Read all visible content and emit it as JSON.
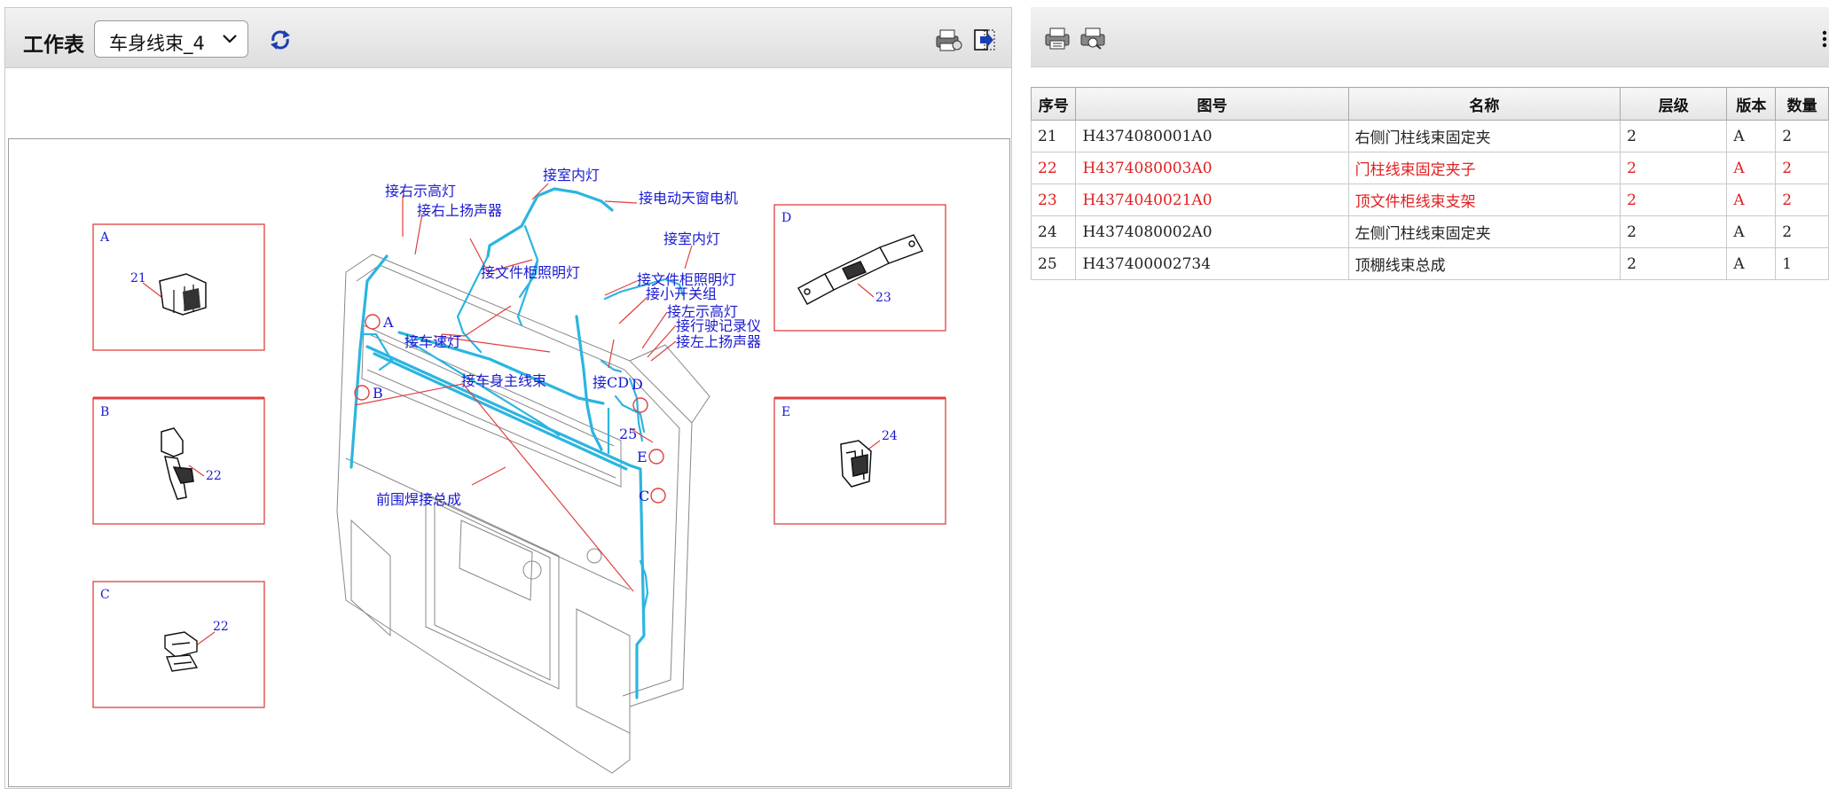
{
  "toolbar": {
    "worksheet_label": "工作表",
    "sheet_selected": "车身线束_4",
    "refresh_icon": "refresh-icon",
    "print_icon": "printer-icon",
    "exit_icon": "exit-icon"
  },
  "diagram": {
    "detail_boxes": [
      {
        "id": "A",
        "part": "21"
      },
      {
        "id": "B",
        "part": "22"
      },
      {
        "id": "C",
        "part": "22"
      },
      {
        "id": "D",
        "part": "23"
      },
      {
        "id": "E",
        "part": "24"
      }
    ],
    "labels": {
      "right_marker_light": "接右示高灯",
      "right_upper_speaker": "接右上扬声器",
      "dome_light_1": "接室内灯",
      "power_sunroof_motor": "接电动天窗电机",
      "cabinet_light_1": "接文件柜照明灯",
      "dome_light_2": "接室内灯",
      "cabinet_light_2": "接文件柜照明灯",
      "small_switch_group": "接小开关组",
      "left_marker_light": "接左示高灯",
      "tachograph": "接行驶记录仪",
      "left_upper_speaker": "接左上扬声器",
      "speed_light": "接车速灯",
      "body_main_harness": "接车身主线束",
      "cd": "接CD",
      "front_panel_weld": "前围焊接总成",
      "part_25": "25"
    },
    "markers": {
      "a": "A",
      "b": "B",
      "c": "C",
      "d": "D",
      "e": "E"
    },
    "colors": {
      "harness": "#2bb5e0",
      "annotation": "#1a1ad2",
      "detail_frame": "#e04040"
    }
  },
  "right_toolbar": {
    "print_icon_1": "printer-icon",
    "print_icon_2": "print-preview-icon"
  },
  "table": {
    "headers": [
      "序号",
      "图号",
      "名称",
      "层级",
      "版本",
      "数量"
    ],
    "rows": [
      {
        "seq": "21",
        "part_no": "H4374080001A0",
        "name": "右侧门柱线束固定夹",
        "level": "2",
        "version": "A",
        "qty": "2",
        "highlight": false
      },
      {
        "seq": "22",
        "part_no": "H4374080003A0",
        "name": "门柱线束固定夹子",
        "level": "2",
        "version": "A",
        "qty": "2",
        "highlight": true
      },
      {
        "seq": "23",
        "part_no": "H4374040021A0",
        "name": "顶文件柜线束支架",
        "level": "2",
        "version": "A",
        "qty": "2",
        "highlight": true
      },
      {
        "seq": "24",
        "part_no": "H4374080002A0",
        "name": "左侧门柱线束固定夹",
        "level": "2",
        "version": "A",
        "qty": "2",
        "highlight": false
      },
      {
        "seq": "25",
        "part_no": "H437400002734",
        "name": "顶棚线束总成",
        "level": "2",
        "version": "A",
        "qty": "1",
        "highlight": false
      }
    ]
  }
}
